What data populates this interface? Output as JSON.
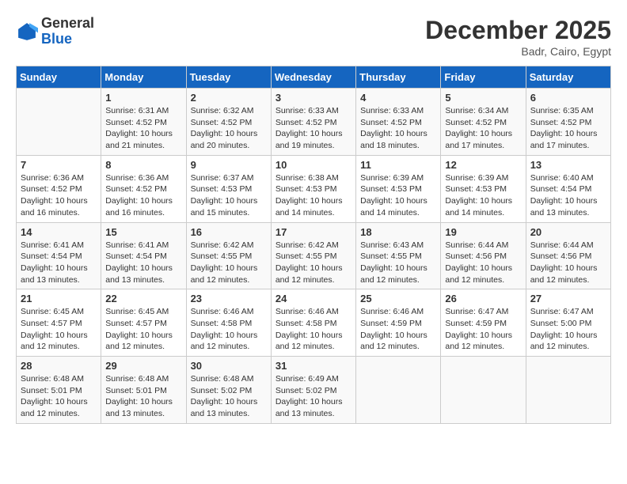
{
  "header": {
    "logo": {
      "general": "General",
      "blue": "Blue"
    },
    "title": "December 2025",
    "location": "Badr, Cairo, Egypt"
  },
  "weekdays": [
    "Sunday",
    "Monday",
    "Tuesday",
    "Wednesday",
    "Thursday",
    "Friday",
    "Saturday"
  ],
  "weeks": [
    [
      {
        "day": "",
        "sunrise": "",
        "sunset": "",
        "daylight": ""
      },
      {
        "day": "1",
        "sunrise": "Sunrise: 6:31 AM",
        "sunset": "Sunset: 4:52 PM",
        "daylight": "Daylight: 10 hours and 21 minutes."
      },
      {
        "day": "2",
        "sunrise": "Sunrise: 6:32 AM",
        "sunset": "Sunset: 4:52 PM",
        "daylight": "Daylight: 10 hours and 20 minutes."
      },
      {
        "day": "3",
        "sunrise": "Sunrise: 6:33 AM",
        "sunset": "Sunset: 4:52 PM",
        "daylight": "Daylight: 10 hours and 19 minutes."
      },
      {
        "day": "4",
        "sunrise": "Sunrise: 6:33 AM",
        "sunset": "Sunset: 4:52 PM",
        "daylight": "Daylight: 10 hours and 18 minutes."
      },
      {
        "day": "5",
        "sunrise": "Sunrise: 6:34 AM",
        "sunset": "Sunset: 4:52 PM",
        "daylight": "Daylight: 10 hours and 17 minutes."
      },
      {
        "day": "6",
        "sunrise": "Sunrise: 6:35 AM",
        "sunset": "Sunset: 4:52 PM",
        "daylight": "Daylight: 10 hours and 17 minutes."
      }
    ],
    [
      {
        "day": "7",
        "sunrise": "Sunrise: 6:36 AM",
        "sunset": "Sunset: 4:52 PM",
        "daylight": "Daylight: 10 hours and 16 minutes."
      },
      {
        "day": "8",
        "sunrise": "Sunrise: 6:36 AM",
        "sunset": "Sunset: 4:52 PM",
        "daylight": "Daylight: 10 hours and 16 minutes."
      },
      {
        "day": "9",
        "sunrise": "Sunrise: 6:37 AM",
        "sunset": "Sunset: 4:53 PM",
        "daylight": "Daylight: 10 hours and 15 minutes."
      },
      {
        "day": "10",
        "sunrise": "Sunrise: 6:38 AM",
        "sunset": "Sunset: 4:53 PM",
        "daylight": "Daylight: 10 hours and 14 minutes."
      },
      {
        "day": "11",
        "sunrise": "Sunrise: 6:39 AM",
        "sunset": "Sunset: 4:53 PM",
        "daylight": "Daylight: 10 hours and 14 minutes."
      },
      {
        "day": "12",
        "sunrise": "Sunrise: 6:39 AM",
        "sunset": "Sunset: 4:53 PM",
        "daylight": "Daylight: 10 hours and 14 minutes."
      },
      {
        "day": "13",
        "sunrise": "Sunrise: 6:40 AM",
        "sunset": "Sunset: 4:54 PM",
        "daylight": "Daylight: 10 hours and 13 minutes."
      }
    ],
    [
      {
        "day": "14",
        "sunrise": "Sunrise: 6:41 AM",
        "sunset": "Sunset: 4:54 PM",
        "daylight": "Daylight: 10 hours and 13 minutes."
      },
      {
        "day": "15",
        "sunrise": "Sunrise: 6:41 AM",
        "sunset": "Sunset: 4:54 PM",
        "daylight": "Daylight: 10 hours and 13 minutes."
      },
      {
        "day": "16",
        "sunrise": "Sunrise: 6:42 AM",
        "sunset": "Sunset: 4:55 PM",
        "daylight": "Daylight: 10 hours and 12 minutes."
      },
      {
        "day": "17",
        "sunrise": "Sunrise: 6:42 AM",
        "sunset": "Sunset: 4:55 PM",
        "daylight": "Daylight: 10 hours and 12 minutes."
      },
      {
        "day": "18",
        "sunrise": "Sunrise: 6:43 AM",
        "sunset": "Sunset: 4:55 PM",
        "daylight": "Daylight: 10 hours and 12 minutes."
      },
      {
        "day": "19",
        "sunrise": "Sunrise: 6:44 AM",
        "sunset": "Sunset: 4:56 PM",
        "daylight": "Daylight: 10 hours and 12 minutes."
      },
      {
        "day": "20",
        "sunrise": "Sunrise: 6:44 AM",
        "sunset": "Sunset: 4:56 PM",
        "daylight": "Daylight: 10 hours and 12 minutes."
      }
    ],
    [
      {
        "day": "21",
        "sunrise": "Sunrise: 6:45 AM",
        "sunset": "Sunset: 4:57 PM",
        "daylight": "Daylight: 10 hours and 12 minutes."
      },
      {
        "day": "22",
        "sunrise": "Sunrise: 6:45 AM",
        "sunset": "Sunset: 4:57 PM",
        "daylight": "Daylight: 10 hours and 12 minutes."
      },
      {
        "day": "23",
        "sunrise": "Sunrise: 6:46 AM",
        "sunset": "Sunset: 4:58 PM",
        "daylight": "Daylight: 10 hours and 12 minutes."
      },
      {
        "day": "24",
        "sunrise": "Sunrise: 6:46 AM",
        "sunset": "Sunset: 4:58 PM",
        "daylight": "Daylight: 10 hours and 12 minutes."
      },
      {
        "day": "25",
        "sunrise": "Sunrise: 6:46 AM",
        "sunset": "Sunset: 4:59 PM",
        "daylight": "Daylight: 10 hours and 12 minutes."
      },
      {
        "day": "26",
        "sunrise": "Sunrise: 6:47 AM",
        "sunset": "Sunset: 4:59 PM",
        "daylight": "Daylight: 10 hours and 12 minutes."
      },
      {
        "day": "27",
        "sunrise": "Sunrise: 6:47 AM",
        "sunset": "Sunset: 5:00 PM",
        "daylight": "Daylight: 10 hours and 12 minutes."
      }
    ],
    [
      {
        "day": "28",
        "sunrise": "Sunrise: 6:48 AM",
        "sunset": "Sunset: 5:01 PM",
        "daylight": "Daylight: 10 hours and 12 minutes."
      },
      {
        "day": "29",
        "sunrise": "Sunrise: 6:48 AM",
        "sunset": "Sunset: 5:01 PM",
        "daylight": "Daylight: 10 hours and 13 minutes."
      },
      {
        "day": "30",
        "sunrise": "Sunrise: 6:48 AM",
        "sunset": "Sunset: 5:02 PM",
        "daylight": "Daylight: 10 hours and 13 minutes."
      },
      {
        "day": "31",
        "sunrise": "Sunrise: 6:49 AM",
        "sunset": "Sunset: 5:02 PM",
        "daylight": "Daylight: 10 hours and 13 minutes."
      },
      {
        "day": "",
        "sunrise": "",
        "sunset": "",
        "daylight": ""
      },
      {
        "day": "",
        "sunrise": "",
        "sunset": "",
        "daylight": ""
      },
      {
        "day": "",
        "sunrise": "",
        "sunset": "",
        "daylight": ""
      }
    ]
  ]
}
